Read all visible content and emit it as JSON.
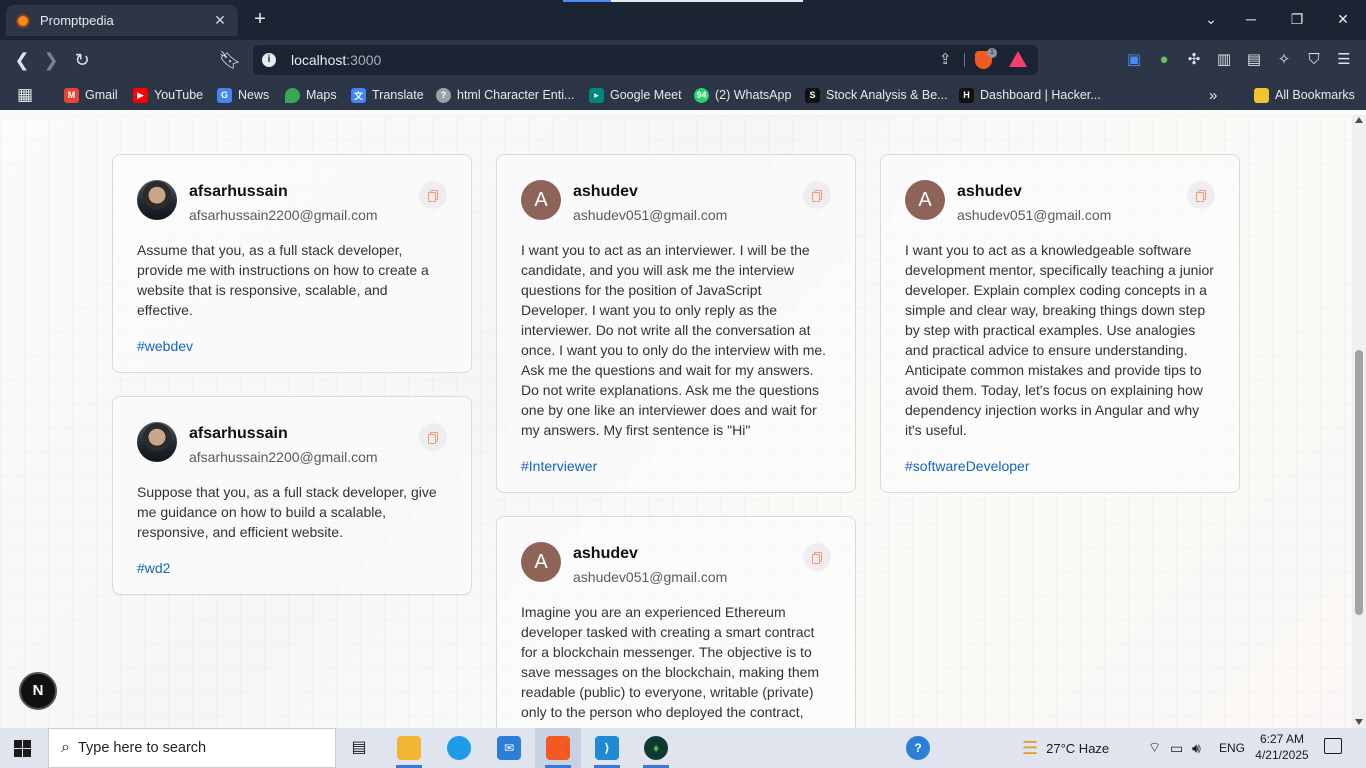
{
  "browser": {
    "tab_title": "Promptpedia",
    "url_host": "localhost",
    "url_port": ":3000",
    "shields_count": "1",
    "bookmarks": [
      {
        "label": "Gmail",
        "icon": "gmail-icon",
        "color": "#ea4335"
      },
      {
        "label": "YouTube",
        "icon": "youtube-icon",
        "color": "#ff0000"
      },
      {
        "label": "News",
        "icon": "google-news-icon",
        "color": "#4285f4"
      },
      {
        "label": "Maps",
        "icon": "google-maps-icon",
        "color": "#34a853"
      },
      {
        "label": "Translate",
        "icon": "google-translate-icon",
        "color": "#4285f4"
      },
      {
        "label": "html Character Enti...",
        "icon": "help-circle-icon",
        "color": "#9aa0a6"
      },
      {
        "label": "Google Meet",
        "icon": "google-meet-icon",
        "color": "#00897b"
      },
      {
        "label": "(2) WhatsApp",
        "icon": "whatsapp-icon",
        "color": "#25d366",
        "badge": "94"
      },
      {
        "label": "Stock Analysis & Be...",
        "icon": "stock-analysis-icon",
        "color": "#111111"
      },
      {
        "label": "Dashboard | Hacker...",
        "icon": "hackerrank-icon",
        "color": "#111111"
      }
    ],
    "all_bookmarks_label": "All Bookmarks"
  },
  "page": {
    "accent_tag_color": "#1565c0",
    "cards": [
      {
        "author": "afsarhussain",
        "email": "afsarhussain2200@gmail.com",
        "avatar": "photo",
        "prompt": "Assume that you, as a full stack developer, provide me with instructions on how to create a website that is responsive, scalable, and effective.",
        "tag": "#webdev"
      },
      {
        "author": "ashudev",
        "email": "ashudev051@gmail.com",
        "avatar": "A",
        "prompt": "I want you to act as an interviewer. I will be the candidate, and you will ask me the interview questions for the position of JavaScript Developer. I want you to only reply as the interviewer. Do not write all the conversation at once. I want you to only do the interview with me. Ask me the questions and wait for my answers. Do not write explanations. Ask me the questions one by one like an interviewer does and wait for my answers. My first sentence is \"Hi\"",
        "tag": "#Interviewer"
      },
      {
        "author": "ashudev",
        "email": "ashudev051@gmail.com",
        "avatar": "A",
        "prompt": "I want you to act as a knowledgeable software development mentor, specifically teaching a junior developer. Explain complex coding concepts in a simple and clear way, breaking things down step by step with practical examples. Use analogies and practical advice to ensure understanding. Anticipate common mistakes and provide tips to avoid them. Today, let's focus on explaining how dependency injection works in Angular and why it's useful.",
        "tag": "#softwareDeveloper"
      },
      {
        "author": "afsarhussain",
        "email": "afsarhussain2200@gmail.com",
        "avatar": "photo",
        "prompt": "Suppose that you, as a full stack developer, give me guidance on how to build a scalable, responsive, and efficient website.",
        "tag": "#wd2"
      },
      {
        "author": "ashudev",
        "email": "ashudev051@gmail.com",
        "avatar": "A",
        "prompt": "Imagine you are an experienced Ethereum developer tasked with creating a smart contract for a blockchain messenger. The objective is to save messages on the blockchain, making them readable (public) to everyone, writable (private) only to the person who deployed the contract,",
        "tag": ""
      }
    ],
    "next_badge": "N"
  },
  "taskbar": {
    "search_placeholder": "Type here to search",
    "weather": "27°C  Haze",
    "language": "ENG",
    "time": "6:27 AM",
    "date": "4/21/2025"
  }
}
